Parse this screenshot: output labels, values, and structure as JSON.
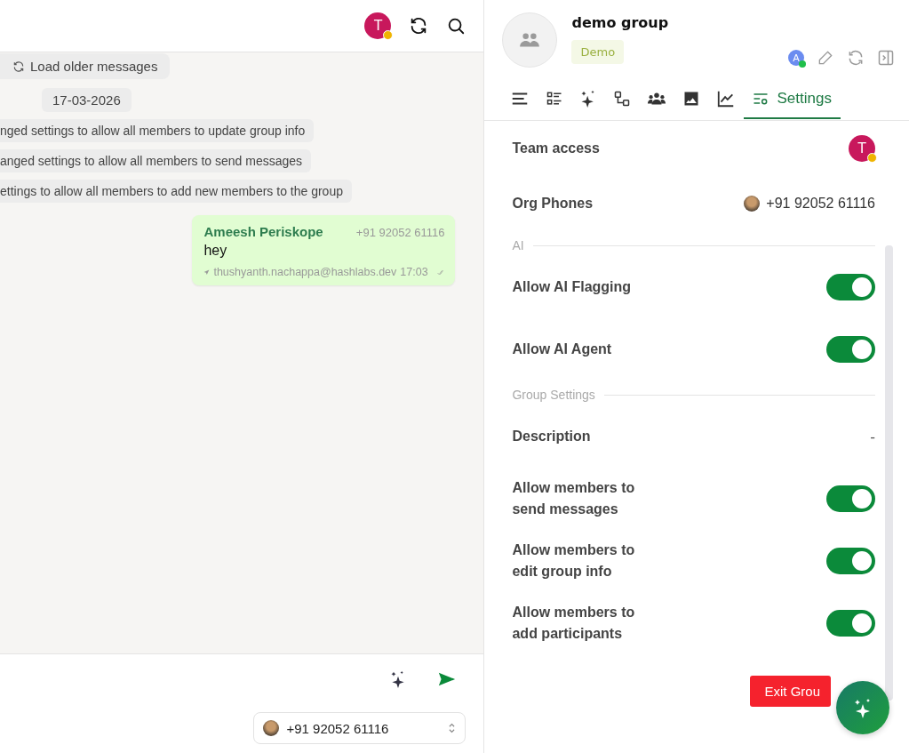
{
  "chat": {
    "header": {
      "avatar_initial": "T"
    },
    "load_older": "Load older messages",
    "date": "17-03-2026",
    "system_messages": [
      "nged settings to allow all members to update group info",
      "anged settings to allow all members to send messages",
      "ettings to allow all members to add new members to the group"
    ],
    "message": {
      "sender": "Ameesh Periskope",
      "phone": "+91 92052 61116",
      "text": "hey",
      "sent_by": "thushyanth.nachappa@hashlabs.dev",
      "time": "17:03",
      "read": true
    },
    "composer": {
      "phone": "+91 92052 61116"
    }
  },
  "panel": {
    "title": "demo group",
    "tag": "Demo",
    "agent_initial": "A",
    "tabs": [
      {
        "kind": "menu",
        "selected": false
      },
      {
        "kind": "list",
        "selected": false
      },
      {
        "kind": "sparkle",
        "selected": false
      },
      {
        "kind": "flow",
        "selected": false
      },
      {
        "kind": "people",
        "selected": false
      },
      {
        "kind": "image",
        "selected": false
      },
      {
        "kind": "chart",
        "selected": false
      },
      {
        "kind": "settings",
        "label": "Settings",
        "selected": true
      }
    ],
    "team_access": {
      "label": "Team access",
      "initial": "T"
    },
    "org_phones": {
      "label": "Org Phones",
      "phone": "+91 92052 61116"
    },
    "sections": [
      {
        "title": "AI",
        "rows": [
          {
            "kind": "toggle",
            "label": "Allow AI Flagging",
            "on": true
          },
          {
            "kind": "toggle",
            "label": "Allow AI Agent",
            "on": true
          }
        ]
      },
      {
        "title": "Group Settings",
        "rows": [
          {
            "kind": "value",
            "label": "Description",
            "value": "-"
          },
          {
            "kind": "toggle",
            "label": "Allow members to send messages",
            "on": true
          },
          {
            "kind": "toggle",
            "label": "Allow members to edit group info",
            "on": true
          },
          {
            "kind": "toggle",
            "label": "Allow members to add participants",
            "on": true
          }
        ]
      }
    ],
    "exit_button": "Exit Grou"
  }
}
